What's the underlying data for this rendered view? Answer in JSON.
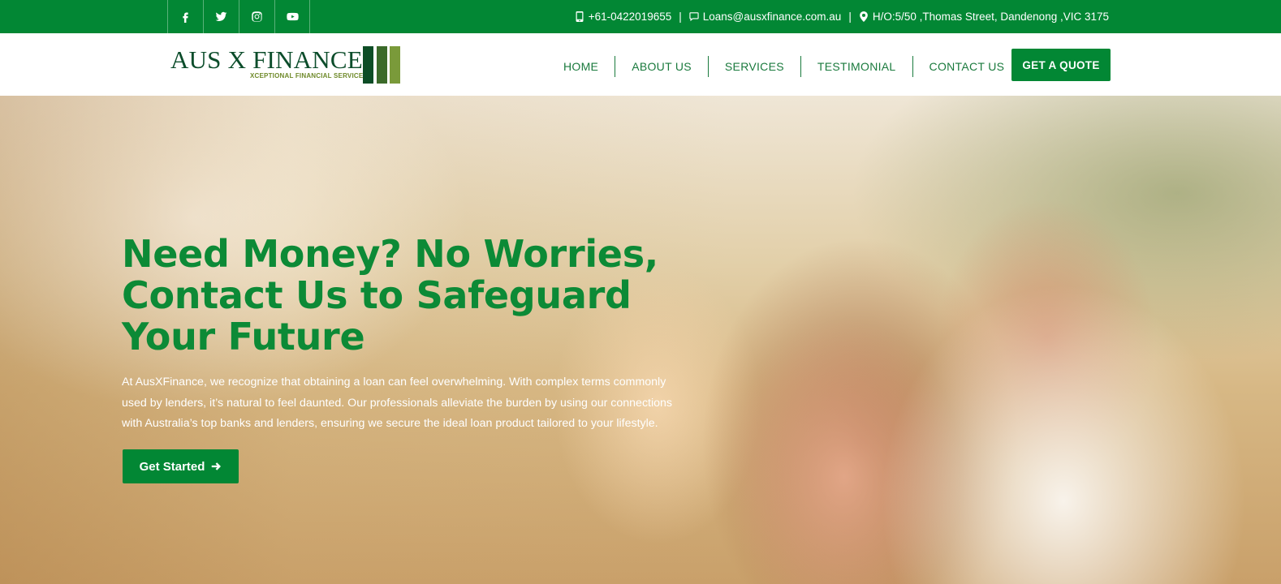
{
  "topbar": {
    "social": [
      {
        "icon": "facebook-icon"
      },
      {
        "icon": "twitter-icon"
      },
      {
        "icon": "instagram-icon"
      },
      {
        "icon": "youtube-icon"
      }
    ],
    "phone": "+61-0422019655",
    "email": "Loans@ausxfinance.com.au",
    "address": "H/O:5/50 ,Thomas Street, Dandenong ,VIC 3175",
    "separator": "|"
  },
  "header": {
    "logo": {
      "name": "AUS X FINANCE",
      "tagline": "XCEPTIONAL FINANCIAL SERVICES",
      "colors": [
        "#0d4d26",
        "#3b6a2a",
        "#7a9a3a"
      ]
    },
    "nav": [
      {
        "label": "HOME"
      },
      {
        "label": "ABOUT US"
      },
      {
        "label": "SERVICES"
      },
      {
        "label": "TESTIMONIAL"
      },
      {
        "label": "CONTACT US"
      }
    ],
    "quote_button": "GET A QUOTE"
  },
  "hero": {
    "title": "Need Money? No Worries, Contact Us to Safeguard Your Future",
    "description": "At AusXFinance, we recognize that obtaining a loan can feel overwhelming. With complex terms commonly used by lenders, it’s natural to feel daunted. Our professionals alleviate the burden by using our connections with Australia’s top banks and lenders, ensuring we secure the ideal loan product tailored to your lifestyle.",
    "cta_label": "Get Started",
    "cta_icon": "arrow-right-icon"
  },
  "colors": {
    "brand_green": "#028734",
    "heading_green": "#0c8a36",
    "logo_dark": "#0c4d2b"
  }
}
